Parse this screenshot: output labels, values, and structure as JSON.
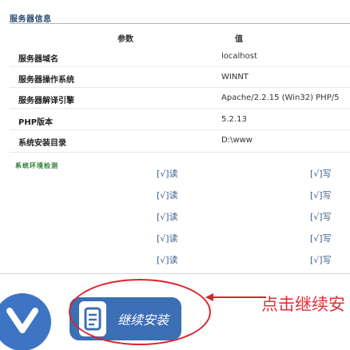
{
  "section_title": "服务器信息",
  "table": {
    "col_param": "参数",
    "col_value": "值",
    "rows": [
      {
        "label": "服务器域名",
        "value": "localhost"
      },
      {
        "label": "服务器操作系统",
        "value": "WINNT"
      },
      {
        "label": "服务器解译引擎",
        "value": "Apache/2.2.15 (Win32) PHP/5"
      },
      {
        "label": "PHP版本",
        "value": "5.2.13"
      },
      {
        "label": "系统安装目录",
        "value": "D:\\www"
      }
    ]
  },
  "env_check": {
    "title": "系统环境检测",
    "rows": [
      {
        "read": "[√]读",
        "write": "[√]写"
      },
      {
        "read": "[√]读",
        "write": "[√]写"
      },
      {
        "read": "[√]读",
        "write": "[√]写"
      },
      {
        "read": "[√]读",
        "write": "[√]写"
      },
      {
        "read": "[√]读",
        "write": "[√]写"
      }
    ]
  },
  "buttons": {
    "install_label": "继续安装"
  },
  "annotation": {
    "text": "点击继续安",
    "color": "#e03038"
  },
  "colors": {
    "button_blue": "#3d6fb5",
    "circle_blue": "#3d75c4",
    "annotation_red": "#d9252b"
  },
  "icons": [
    "back-chevron-icon",
    "install-document-icon"
  ]
}
